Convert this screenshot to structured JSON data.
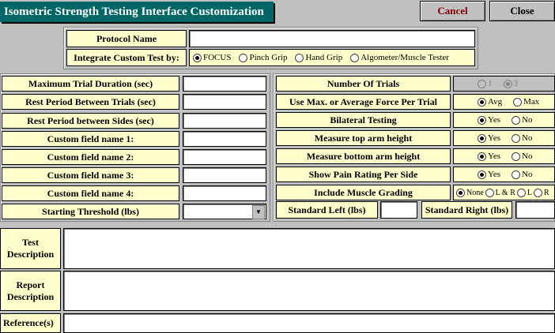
{
  "window": {
    "title": "Isometric Strength Testing Interface Customization"
  },
  "buttons": {
    "cancel": "Cancel",
    "close": "Close"
  },
  "protocol": {
    "name_label": "Protocol Name",
    "name_value": "",
    "integrate_label": "Integrate Custom Test by:",
    "integrate_options": [
      "FOCUS",
      "Pinch Grip",
      "Hand Grip",
      "Algometer/Muscle Tester"
    ],
    "integrate_selected": "FOCUS"
  },
  "left_fields": [
    {
      "label": "Maximum Trial Duration (sec)",
      "value": ""
    },
    {
      "label": "Rest Period Between Trials (sec)",
      "value": ""
    },
    {
      "label": "Rest Period between Sides (sec)",
      "value": ""
    },
    {
      "label": "Custom field name 1:",
      "value": ""
    },
    {
      "label": "Custom field name 2:",
      "value": ""
    },
    {
      "label": "Custom field name 3:",
      "value": ""
    },
    {
      "label": "Custom field name 4:",
      "value": ""
    },
    {
      "label": "Starting Threshold (lbs)",
      "value": ""
    }
  ],
  "right_options": [
    {
      "label": "Number Of Trials",
      "options": [
        "1",
        "3"
      ],
      "selected": "3",
      "disabled": true
    },
    {
      "label": "Use Max. or Average Force Per Trial",
      "options": [
        "Avg",
        "Max"
      ],
      "selected": "Avg"
    },
    {
      "label": "Bilateral Testing",
      "options": [
        "Yes",
        "No"
      ],
      "selected": "Yes"
    },
    {
      "label": "Measure top arm height",
      "options": [
        "Yes",
        "No"
      ],
      "selected": "Yes"
    },
    {
      "label": "Measure bottom arm height",
      "options": [
        "Yes",
        "No"
      ],
      "selected": "Yes"
    },
    {
      "label": "Show Pain Rating Per Side",
      "options": [
        "Yes",
        "No"
      ],
      "selected": "Yes"
    },
    {
      "label": "Include Muscle Grading",
      "options": [
        "None",
        "L & R",
        "L",
        "R"
      ],
      "selected": "None"
    }
  ],
  "standard": {
    "left_label": "Standard Left (lbs)",
    "left_value": "",
    "right_label": "Standard Right (lbs)",
    "right_value": ""
  },
  "bottom": {
    "test_description_label": "Test Description",
    "report_description_label": "Report Description",
    "references_label": "Reference(s)"
  }
}
